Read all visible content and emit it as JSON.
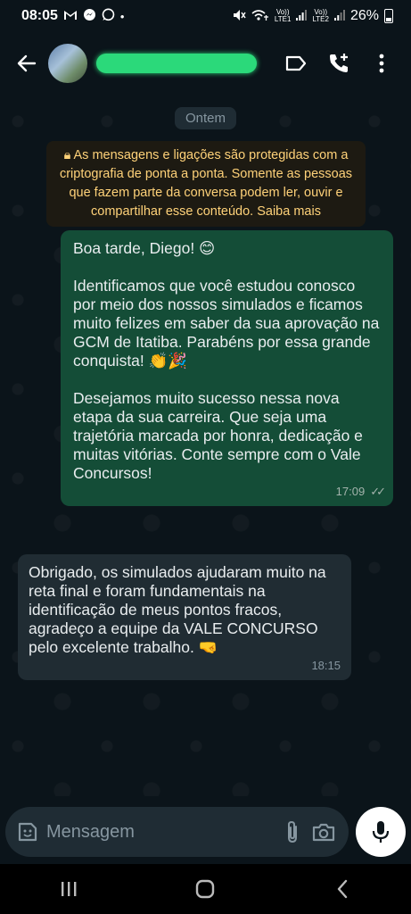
{
  "status_bar": {
    "time": "08:05",
    "sim1": "LTE1",
    "sim2": "LTE2",
    "volte": "Vo))",
    "battery": "26%"
  },
  "header": {
    "avatar_icon": "contact-avatar",
    "actions": [
      "label-icon",
      "add-call-icon",
      "more-options-icon"
    ]
  },
  "chat": {
    "date_chip": "Ontem",
    "encryption_notice": "As mensagens e ligações são protegidas com a criptografia de ponta a ponta. Somente as pessoas que fazem parte da conversa podem ler, ouvir e compartilhar esse conteúdo. Saiba mais",
    "messages": [
      {
        "direction": "outgoing",
        "paragraphs": [
          "Boa tarde, Diego! 😊",
          "Identificamos que você estudou conosco por meio dos nossos simulados e ficamos muito felizes em saber da sua aprovação na GCM de Itatiba. Parabéns por essa grande conquista! 👏🎉",
          "Desejamos muito sucesso nessa nova etapa da sua carreira. Que seja uma trajetória marcada por honra, dedicação e muitas vitórias. Conte sempre com o Vale Concursos!"
        ],
        "time": "17:09",
        "status": "✓✓"
      },
      {
        "direction": "incoming",
        "paragraphs": [
          "Obrigado,  os simulados ajudaram muito na reta final e foram fundamentais na identificação de meus pontos fracos, agradeço a equipe da VALE CONCURSO pelo excelente trabalho. 🤜"
        ],
        "time": "18:15"
      }
    ]
  },
  "composer": {
    "placeholder": "Mensagem"
  },
  "colors": {
    "background": "#0b141a",
    "outgoing_bubble": "#144d37",
    "incoming_bubble": "#202c33",
    "notice_text": "#ffd279"
  }
}
